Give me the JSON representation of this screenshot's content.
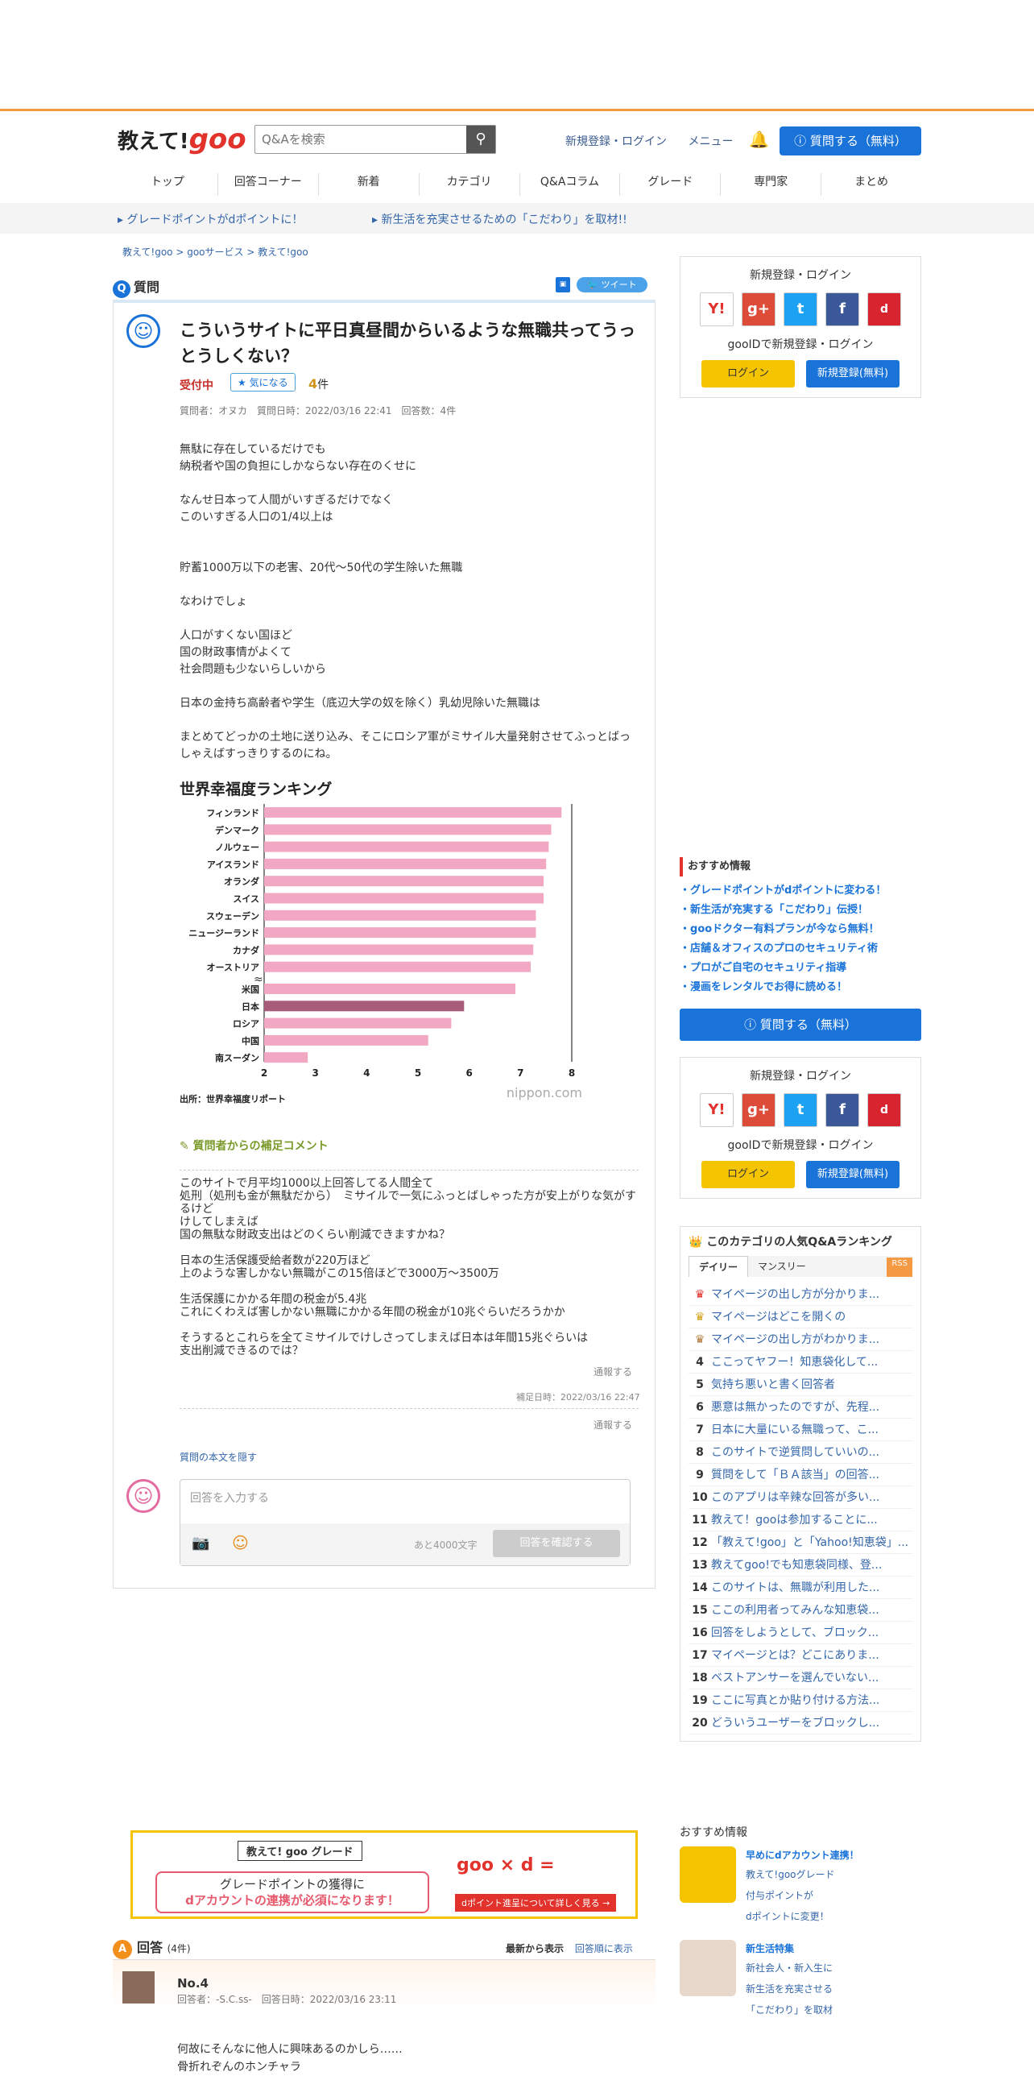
{
  "header": {
    "logo_text": "教えて!",
    "logo_brand": "goo",
    "search_placeholder": "Q&Aを検索",
    "login_link": "新規登録・ログイン",
    "menu_link": "メニュー",
    "ask_button": "質問する（無料）"
  },
  "nav": [
    "トップ",
    "回答コーナー",
    "新着",
    "カテゴリ",
    "Q&Aコラム",
    "グレード",
    "専門家",
    "まとめ"
  ],
  "notices": [
    "グレードポイントがdポイントに！",
    "新生活を充実させるための「こだわり」を取材!!"
  ],
  "breadcrumb": [
    "教えて!goo",
    "gooサービス",
    "教えて!goo"
  ],
  "question": {
    "section_label": "質問",
    "tweet_label": "ツイート",
    "title": "こういうサイトに平日真昼間からいるような無職共ってうっとうしくない？",
    "status": "受付中",
    "fav_label": "気になる",
    "fav_count": "4",
    "fav_unit": "件",
    "meta": "質問者：オヌカ　質問日時：2022/03/16 22:41　回答数：4件",
    "body": "無駄に存在しているだけでも\n納税者や国の負担にしかならない存在のくせに\n\nなんせ日本って人間がいすぎるだけでなく\nこのいすぎる人口の1/4以上は\n\n\n貯蓄1000万以下の老害、20代～50代の学生除いた無職\n\nなわけでしょ\n\n人口がすくない国ほど\n国の財政事情がよくて\n社会問題も少ないらしいから\n\n日本の金持ち高齢者や学生（底辺大学の奴を除く）乳幼児除いた無職は\n\nまとめてどっかの土地に送り込み、そこにロシア軍がミサイル大量発射させてふっとばっしゃえばすっきりするのにね。",
    "supplement_head": "質問者からの補足コメント",
    "supplement": "このサイトで月平均1000以上回答してる人間全て\n処刑（処刑も金が無駄だから）　ミサイルで一気にふっとばしゃった方が安上がりな気がするけど\nけしてしまえば\n国の無駄な財政支出はどのくらい削減できますかね？\n\n日本の生活保護受給者数が220万ほど\n上のような害しかない無職がこの15倍ほどで3000万～3500万\n\n生活保護にかかる年間の税金が5.4兆\nこれにくわえば害しかない無職にかかる年間の税金が10兆ぐらいだろうかか\n\nそうするとこれらを全てミサイルでけしさってしまえば日本は年間15兆ぐらいは\n支出削減できるのでは？",
    "report": "通報する",
    "supplement_date": "補足日時：2022/03/16 22:47",
    "hide_link": "質問の本文を隠す",
    "answer_placeholder": "回答を入力する",
    "remaining": "あと4000文字",
    "confirm_button": "回答を確認する"
  },
  "chart_data": {
    "type": "bar",
    "title": "世界幸福度ランキング",
    "source": "出所：世界幸福度リポート",
    "watermark": "nippon.com",
    "categories": [
      "フィンランド",
      "デンマーク",
      "ノルウェー",
      "アイスランド",
      "オランダ",
      "スイス",
      "スウェーデン",
      "ニュージーランド",
      "カナダ",
      "オーストリア",
      "米国",
      "日本",
      "ロシア",
      "中国",
      "南スーダン"
    ],
    "values": [
      7.8,
      7.6,
      7.55,
      7.5,
      7.45,
      7.45,
      7.3,
      7.3,
      7.25,
      7.2,
      6.9,
      5.9,
      5.65,
      5.2,
      2.85
    ],
    "highlight": "日本",
    "xlim": [
      2,
      8
    ],
    "xticks": [
      "2",
      "3",
      "4",
      "5",
      "6",
      "7",
      "8"
    ],
    "colors": {
      "bar": "#f2a7c2",
      "highlight": "#a85c78"
    }
  },
  "banner": {
    "title": "教えて! goo グレード",
    "line1": "グレードポイントの獲得に",
    "line2": "dアカウントの連携が必須になります！",
    "brand": "goo × d = ",
    "cta": "dポイント進呈について詳しく見る →"
  },
  "answers": {
    "label": "回答",
    "count": "(4件)",
    "sort_new": "最新から表示",
    "sort_old": "回答順に表示",
    "first": {
      "no": "No.4",
      "meta": "回答者：-S.C.ss-　回答日時：2022/03/16 23:11",
      "text": "何故にそんなに他人に興味あるのかしら……\n骨折れぞんのホンチャラ"
    }
  },
  "sidebar": {
    "login_title": "新規登録・ログイン",
    "goo_id": "gooIDで新規登録・ログイン",
    "login_btn": "ログイン",
    "register_btn": "新規登録(無料)",
    "rec_title": "おすすめ情報",
    "rec_links": [
      "グレードポイントがdポイントに変わる！",
      "新生活が充実する「こだわり」伝授！",
      "gooドクター有料プランが今なら無料！",
      "店舗＆オフィスのプロのセキュリティ術",
      "プロがご自宅のセキュリティ指導",
      "漫画をレンタルでお得に読める！"
    ],
    "ask_btn": "質問する（無料）",
    "rank_title": "このカテゴリの人気Q&Aランキング",
    "tab_daily": "デイリー",
    "tab_monthly": "マンスリー",
    "rss": "RSS",
    "ranking": [
      "マイページの出し方が分かりま...",
      "マイページはどこを開くの",
      "マイページの出し方がわかりま...",
      "ここってヤフー！知恵袋化して...",
      "気持ち悪いと書く回答者",
      "悪意は無かったのですが、先程...",
      "日本に大量にいる無職って、こ...",
      "このサイトで逆質問していいの...",
      "質問をして「ＢＡ該当」の回答...",
      "このアプリは辛辣な回答が多い...",
      "教えて！gooは参加することに...",
      "「教えて!goo」と「Yahoo!知恵袋」...",
      "教えてgoo!でも知恵袋同様、登...",
      "このサイトは、無職が利用した...",
      "ここの利用者ってみんな知恵袋...",
      "回答をしようとして、ブロック...",
      "マイページとは？どこにありま...",
      "ベストアンサーを選んでいない...",
      "ここに写真とか貼り付ける方法...",
      "どういうユーザーをブロックし..."
    ],
    "rec2_title": "おすすめ情報",
    "rec2_a_head": "早めにdアカウント連携！",
    "rec2_a": [
      "教えて!gooグレード",
      "付与ポイントが",
      "dポイントに変更！"
    ],
    "rec2_b_head": "新生活特集",
    "rec2_b": [
      "新社会人・新入生に",
      "新生活を充実させる",
      "「こだわり」を取材"
    ]
  }
}
